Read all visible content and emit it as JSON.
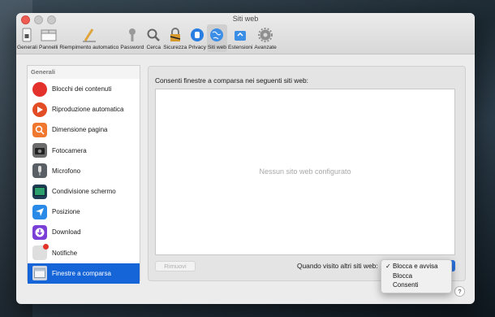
{
  "window": {
    "title": "Siti web"
  },
  "toolbar": {
    "items": [
      {
        "label": "Generali",
        "icon": "switch-icon"
      },
      {
        "label": "Pannelli",
        "icon": "tabs-icon"
      },
      {
        "label": "Riempimento automatico",
        "icon": "pencil-icon"
      },
      {
        "label": "Password",
        "icon": "key-icon"
      },
      {
        "label": "Cerca",
        "icon": "magnifier-icon"
      },
      {
        "label": "Sicurezza",
        "icon": "padlock-icon"
      },
      {
        "label": "Privacy",
        "icon": "hand-icon"
      },
      {
        "label": "Siti web",
        "icon": "globe-icon",
        "active": true
      },
      {
        "label": "Estensioni",
        "icon": "puzzle-icon"
      },
      {
        "label": "Avanzate",
        "icon": "gear-icon"
      }
    ]
  },
  "sidebar": {
    "header": "Generali",
    "items": [
      {
        "label": "Blocchi dei contenuti",
        "icon": "stop-icon",
        "color": "#e3322b"
      },
      {
        "label": "Riproduzione automatica",
        "icon": "play-icon",
        "color": "#e34d25"
      },
      {
        "label": "Dimensione pagina",
        "icon": "zoom-icon",
        "color": "#f0782e"
      },
      {
        "label": "Fotocamera",
        "icon": "camera-icon",
        "color": "#6b6b6b"
      },
      {
        "label": "Microfono",
        "icon": "microphone-icon",
        "color": "#5a5f66"
      },
      {
        "label": "Condivisione schermo",
        "icon": "screen-share-icon",
        "color": "#2ca06c"
      },
      {
        "label": "Posizione",
        "icon": "location-arrow-icon",
        "color": "#2a8ae8"
      },
      {
        "label": "Download",
        "icon": "download-icon",
        "color": "#7a3fd6"
      },
      {
        "label": "Notifiche",
        "icon": "notification-icon",
        "color": "#d8d8d8"
      },
      {
        "label": "Finestre a comparsa",
        "icon": "popup-window-icon",
        "color": "#cfd6df",
        "selected": true
      }
    ]
  },
  "panel": {
    "title": "Consenti finestre a comparsa nei seguenti siti web:",
    "empty_text": "Nessun sito web configurato",
    "remove_button": "Rimuovi",
    "when_visiting": "Quando visito altri siti web:"
  },
  "popup_menu": {
    "options": [
      "Blocca e avvisa",
      "Blocca",
      "Consenti"
    ],
    "selected": "Blocca e avvisa",
    "check": "✓"
  },
  "help_label": "?"
}
